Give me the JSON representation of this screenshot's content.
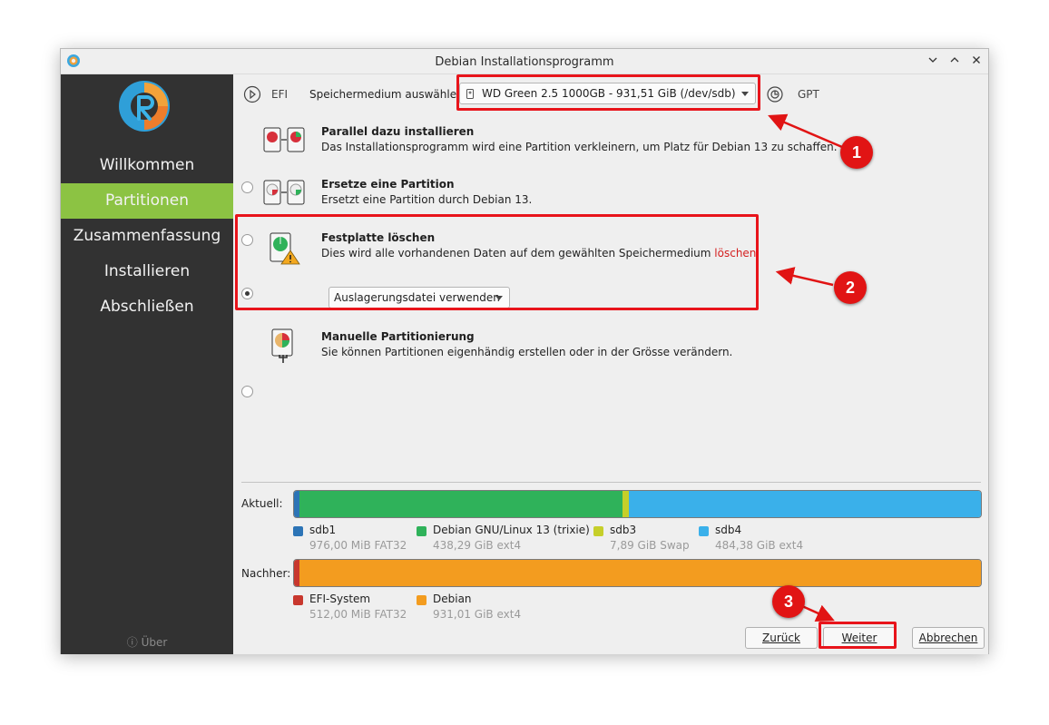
{
  "window": {
    "title": "Debian Installationsprogramm",
    "controls": [
      "minimize-icon",
      "maximize-icon",
      "close-icon"
    ]
  },
  "sidebar": {
    "items": [
      {
        "label": "Willkommen",
        "active": false
      },
      {
        "label": "Partitionen",
        "active": true
      },
      {
        "label": "Zusammenfassung",
        "active": false
      },
      {
        "label": "Installieren",
        "active": false
      },
      {
        "label": "Abschließen",
        "active": false
      }
    ],
    "about_label": "Über",
    "about_icon": "info-icon"
  },
  "topbar": {
    "efi_label": "EFI",
    "storage_label": "Speichermedium auswählen:",
    "storage_value": "WD Green 2.5 1000GB - 931,51 GiB (/dev/sdb)",
    "gpt_label": "GPT"
  },
  "options": [
    {
      "title": "Parallel dazu installieren",
      "desc": "Das Installationsprogramm wird eine Partition verkleinern, um Platz für Debian 13 zu schaffen.",
      "checked": false
    },
    {
      "title": "Ersetze eine Partition",
      "desc": "Ersetzt eine Partition durch Debian 13.",
      "checked": false
    },
    {
      "title": "Festplatte löschen",
      "desc_before": "Dies wird alle vorhandenen Daten auf dem gewählten Speichermedium ",
      "desc_highlight": "löschen",
      "desc_after": ".",
      "checked": true,
      "swap_value": "Auslagerungsdatei verwenden"
    },
    {
      "title": "Manuelle Partitionierung",
      "desc": "Sie können Partitionen eigenhändig erstellen oder in der Grösse verändern.",
      "checked": false
    }
  ],
  "current": {
    "label": "Aktuell:",
    "partitions": [
      {
        "name": "sdb1",
        "info": "976,00 MiB FAT32",
        "color": "#2c74b6",
        "size_gib": 0.95
      },
      {
        "name": "Debian GNU/Linux 13 (trixie)",
        "info": "438,29 GiB ext4",
        "color": "#2fb25a",
        "size_gib": 438.29
      },
      {
        "name": "sdb3",
        "info": "7,89 GiB Swap",
        "color": "#c6cf2a",
        "size_gib": 7.89
      },
      {
        "name": "sdb4",
        "info": "484,38 GiB ext4",
        "color": "#3ab0ea",
        "size_gib": 484.38
      }
    ]
  },
  "after": {
    "label": "Nachher:",
    "partitions": [
      {
        "name": "EFI-System",
        "info": "512,00 MiB FAT32",
        "color": "#c8372d",
        "size_gib": 0.5
      },
      {
        "name": "Debian",
        "info": "931,01 GiB ext4",
        "color": "#f39c1f",
        "size_gib": 931.01
      }
    ]
  },
  "buttons": {
    "back": "Zurück",
    "next": "Weiter",
    "cancel": "Abbrechen"
  },
  "annotations": [
    {
      "number": "1"
    },
    {
      "number": "2"
    },
    {
      "number": "3"
    }
  ],
  "colors": {
    "accent": "#8cc343",
    "annotation": "#e8141b",
    "delete_word": "#d42020"
  }
}
